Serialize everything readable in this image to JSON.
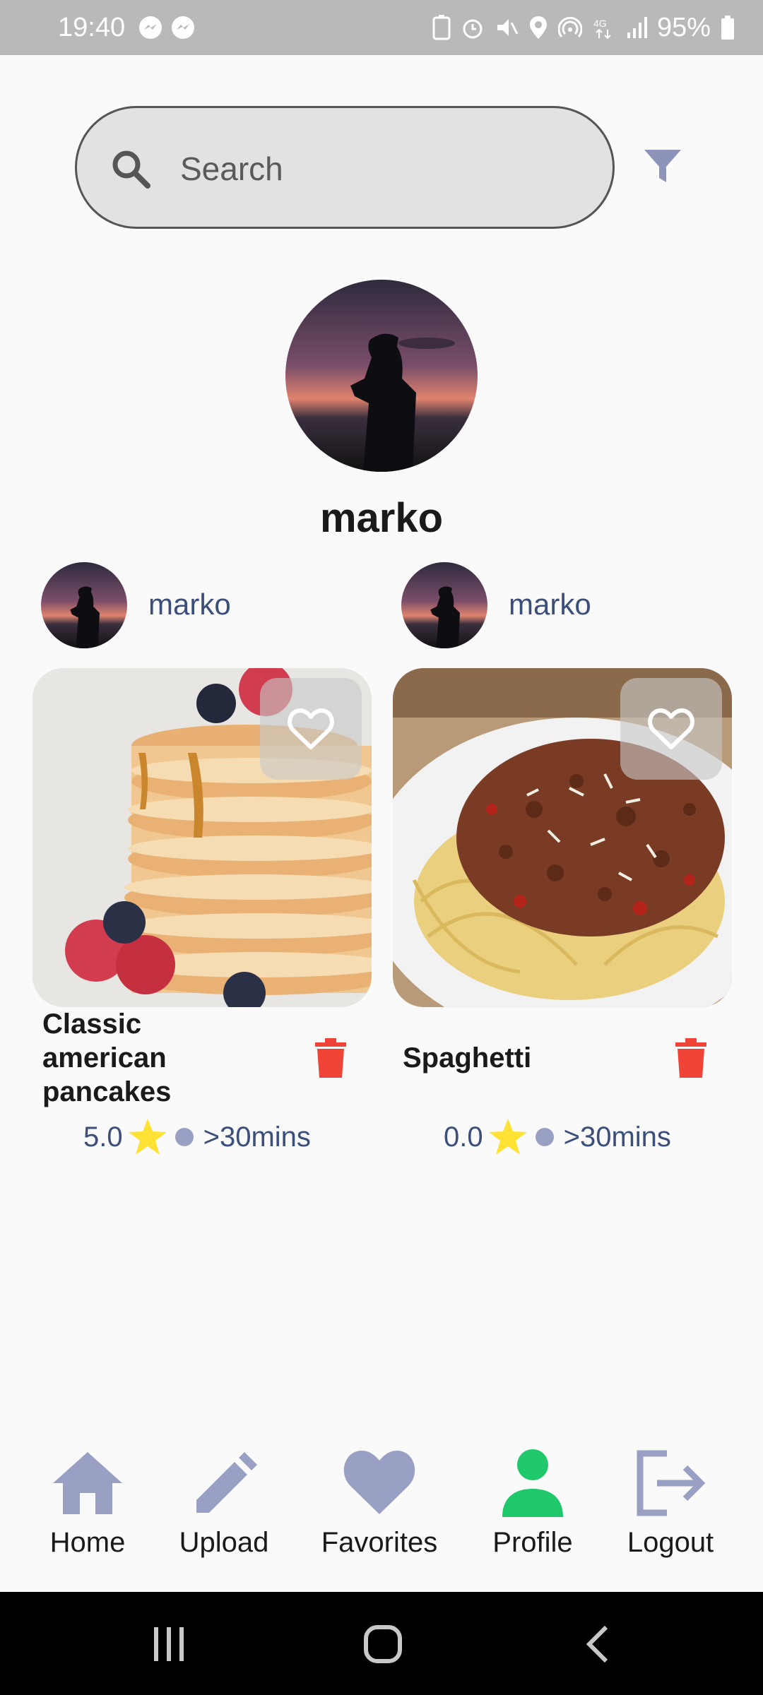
{
  "status_bar": {
    "time": "19:40",
    "battery": "95%",
    "icons": [
      "messenger-icon",
      "messenger-icon",
      "battery-saver-icon",
      "alarm-icon",
      "vibrate-icon",
      "location-icon",
      "hotspot-icon",
      "4g-icon",
      "signal-icon",
      "battery-icon"
    ]
  },
  "search": {
    "placeholder": "Search"
  },
  "profile": {
    "name": "marko"
  },
  "recipes": [
    {
      "author": "marko",
      "title_lines": [
        "Classic",
        "american",
        "pancakes"
      ],
      "rating": "5.0",
      "time": ">30mins"
    },
    {
      "author": "marko",
      "title_lines": [
        "Spaghetti"
      ],
      "rating": "0.0",
      "time": ">30mins"
    }
  ],
  "nav": {
    "home": "Home",
    "upload": "Upload",
    "favorites": "Favorites",
    "profile": "Profile",
    "logout": "Logout"
  },
  "colors": {
    "accent_active": "#1fc86b",
    "nav_inactive": "#9aa0c4",
    "delete": "#f04438",
    "star": "#ffe234",
    "link_text": "#3b4f7a"
  }
}
